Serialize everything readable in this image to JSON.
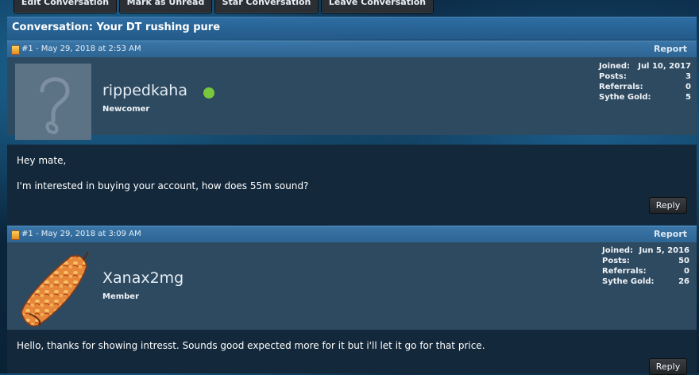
{
  "toolbar": {
    "edit": "Edit Conversation",
    "mark_unread": "Mark as Unread",
    "star": "Star Conversation",
    "leave": "Leave Conversation"
  },
  "conversation": {
    "title": "Conversation: Your DT rushing pure"
  },
  "posts": [
    {
      "number": "#1",
      "date": "- May 29, 2018 at 2:53 AM",
      "report_label": "Report",
      "username": "rippedkaha",
      "online": true,
      "rank": "Newcomer",
      "stats": [
        {
          "label": "Joined:",
          "value": "Jul 10, 2017"
        },
        {
          "label": "Posts:",
          "value": "3"
        },
        {
          "label": "Referrals:",
          "value": "0"
        },
        {
          "label": "Sythe Gold:",
          "value": "5"
        }
      ],
      "message_lines": [
        "Hey mate,",
        "I'm interested in buying your account, how does 55m sound?"
      ],
      "reply_label": "Reply"
    },
    {
      "number": "#1",
      "date": "- May 29, 2018 at 3:09 AM",
      "report_label": "Report",
      "username": "Xanax2mg",
      "online": false,
      "rank": "Member",
      "stats": [
        {
          "label": "Joined:",
          "value": "Jun 5, 2016"
        },
        {
          "label": "Posts:",
          "value": "50"
        },
        {
          "label": "Referrals:",
          "value": "0"
        },
        {
          "label": "Sythe Gold:",
          "value": "26"
        }
      ],
      "message_lines": [
        "Hello, thanks for showing intresst. Sounds good expected more for it but i'll let it go for that price."
      ],
      "reply_label": "Reply"
    }
  ],
  "colors": {
    "header_blue": "#2e6da2",
    "user_panel": "#2e4a60",
    "message_panel": "#13283a",
    "online_dot": "#79c73b"
  },
  "icons": [
    "post-number-icon",
    "default-avatar-icon",
    "leopard-print-avatar"
  ]
}
